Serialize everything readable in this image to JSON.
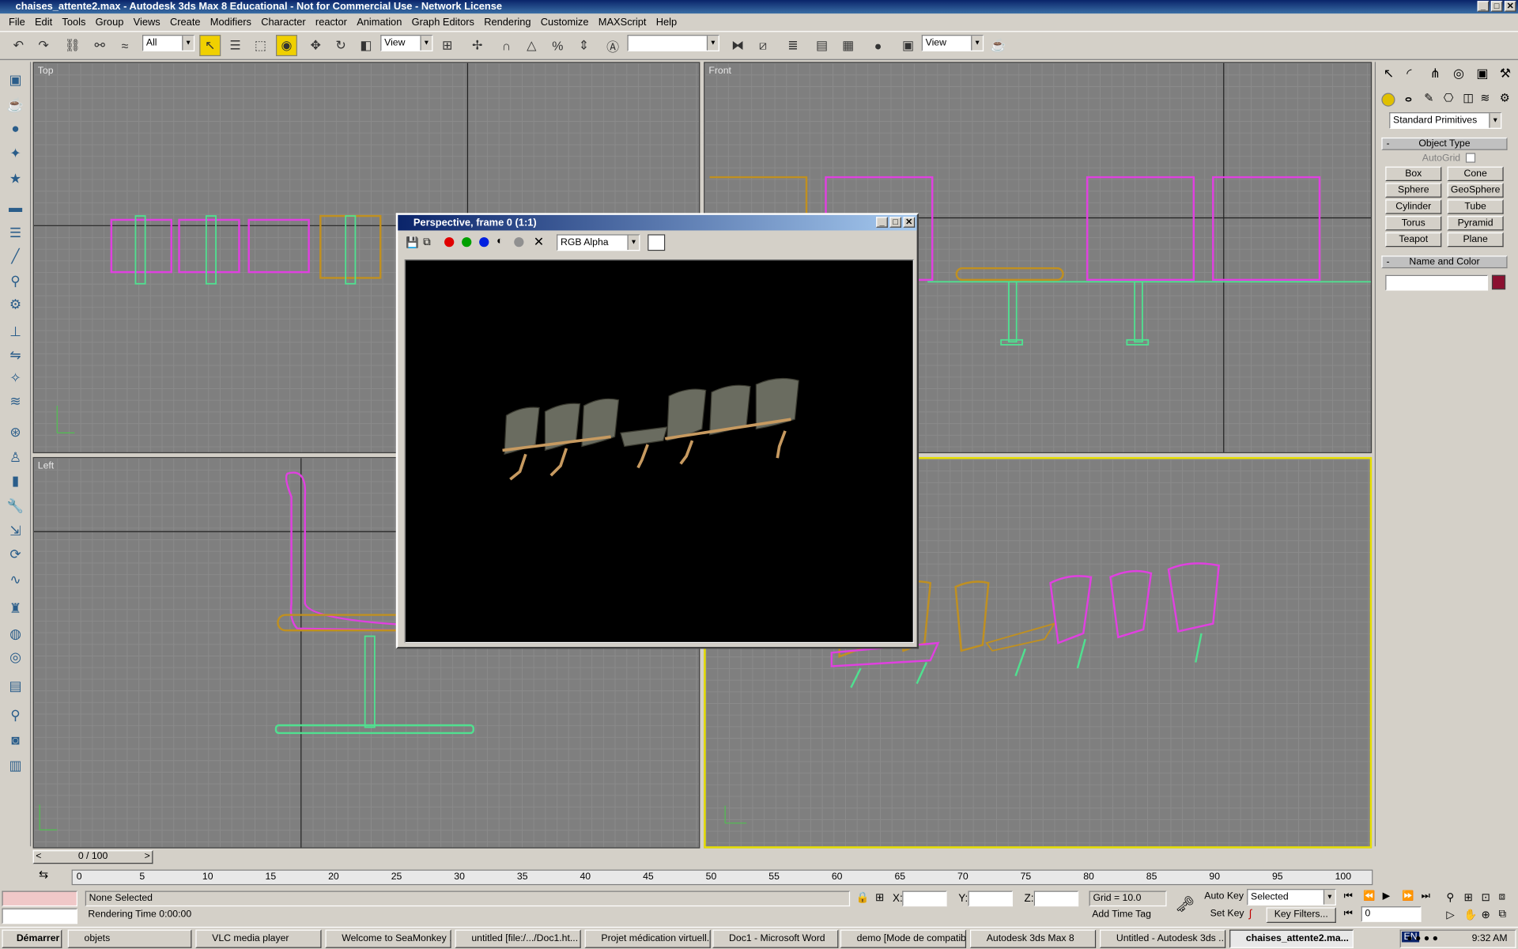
{
  "window": {
    "title": "chaises_attente2.max - Autodesk 3ds Max 8  Educational - Not for Commercial Use - Network License",
    "controls": [
      "_",
      "□",
      "✕"
    ]
  },
  "menu": [
    "File",
    "Edit",
    "Tools",
    "Group",
    "Views",
    "Create",
    "Modifiers",
    "Character",
    "reactor",
    "Animation",
    "Graph Editors",
    "Rendering",
    "Customize",
    "MAXScript",
    "Help"
  ],
  "toolbar": {
    "selection_filter": "All",
    "ref_coord": "View",
    "named_selection": "",
    "render_view": "View"
  },
  "viewports": {
    "top": "Top",
    "front": "Front",
    "left": "Left",
    "perspective": "Perspective"
  },
  "render_window": {
    "title": "Perspective, frame 0 (1:1)",
    "channel": "RGB Alpha"
  },
  "command_panel": {
    "category": "Standard Primitives",
    "object_type_header": "Object Type",
    "autogrid": "AutoGrid",
    "buttons": [
      "Box",
      "Cone",
      "Sphere",
      "GeoSphere",
      "Cylinder",
      "Tube",
      "Torus",
      "Pyramid",
      "Teapot",
      "Plane"
    ],
    "name_color_header": "Name and Color",
    "name_value": "",
    "color": "#8b1030"
  },
  "timeline": {
    "slider": "0 / 100",
    "ticks": [
      "0",
      "5",
      "10",
      "15",
      "20",
      "25",
      "30",
      "35",
      "40",
      "45",
      "50",
      "55",
      "60",
      "65",
      "70",
      "75",
      "80",
      "85",
      "90",
      "95",
      "100"
    ]
  },
  "status": {
    "selection": "None Selected",
    "prompt": "Rendering Time  0:00:00",
    "x_label": "X:",
    "y_label": "Y:",
    "z_label": "Z:",
    "grid": "Grid = 10.0",
    "add_time_tag": "Add Time Tag",
    "auto_key": "Auto Key",
    "set_key": "Set Key",
    "key_mode": "Selected",
    "key_filters": "Key Filters...",
    "frame": "0"
  },
  "taskbar": {
    "start": "Démarrer",
    "tasks": [
      "objets",
      "VLC media player",
      "Welcome to SeaMonkey ...",
      "untitled [file:/.../Doc1.ht...",
      "Projet médication virtuell...",
      "Doc1 - Microsoft Word",
      "demo [Mode de compatib...",
      "Autodesk 3ds Max 8",
      "Untitled - Autodesk 3ds ...",
      "chaises_attente2.ma..."
    ],
    "lang": "EN",
    "clock": "9:32 AM"
  }
}
